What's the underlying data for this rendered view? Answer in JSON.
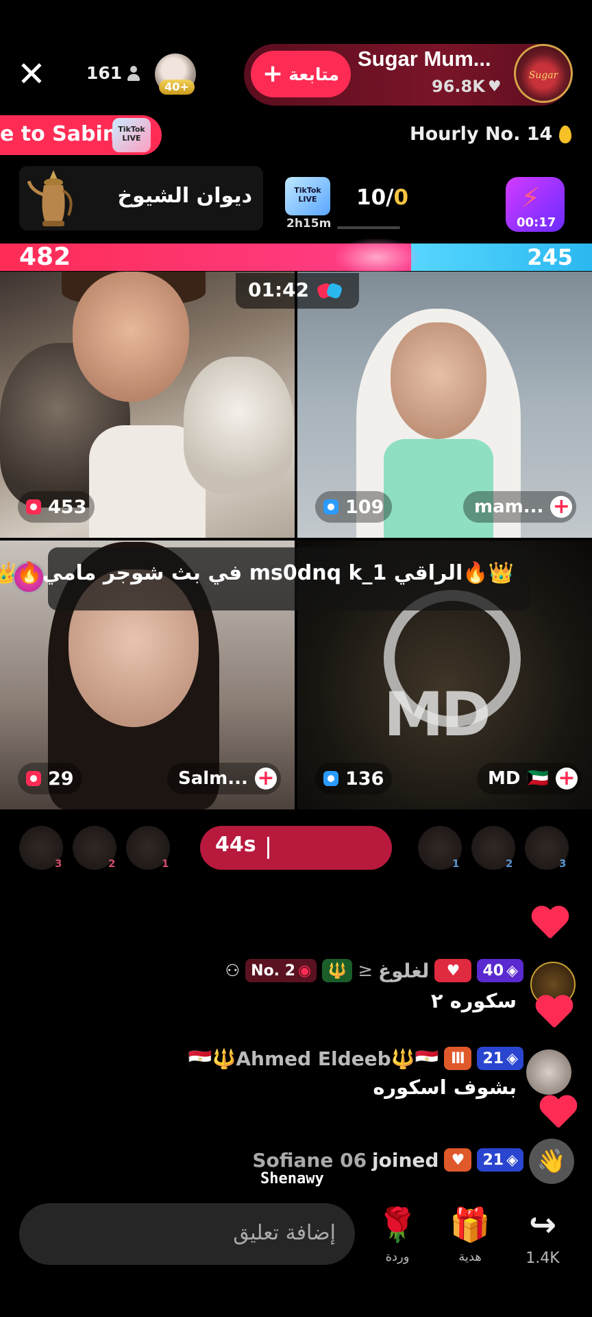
{
  "header": {
    "close_glyph": "✕",
    "viewer_count": "161",
    "top_gifter_badge": "40+",
    "follow_label": "متابعة",
    "follow_plus": "+",
    "host_name": "Sugar Mum...",
    "host_likes": "96.8K",
    "host_avatar_text": "Sugar",
    "heart_glyph": "♥"
  },
  "banners": {
    "sabina_text": "e to Sabina",
    "sabina_icon_text": "TikTok LIVE",
    "hourly_rank": "Hourly No. 14"
  },
  "battle_info": {
    "diwan_name": "ديوان الشيوخ",
    "tiktok_box_text": "TikTok LIVE",
    "tiktok_time": "2h15m",
    "score_prefix": "10/",
    "score_suffix": "0",
    "lightning_time": "00:17",
    "lightning_glyph": "⚡"
  },
  "battle_bar": {
    "left_score": "482",
    "right_score": "245",
    "left_color": "#fe2c55",
    "right_color": "#2bb8f0"
  },
  "grid": {
    "timer": "01:42",
    "tiles": [
      {
        "count": "453",
        "name": ""
      },
      {
        "count": "109",
        "name": "mam..."
      },
      {
        "count": "29",
        "name": "Salm..."
      },
      {
        "count": "136",
        "name": "MD 🇰🇼"
      }
    ],
    "announcement": "👑🔥الراقي ms0dnq k_1 في بث شوجر مامي🔥👑",
    "md_logo": "MD"
  },
  "footer_battle": {
    "countdown": "44s",
    "left_supporter_ranks": [
      "3",
      "2",
      "1"
    ],
    "right_supporter_ranks": [
      "1",
      "2",
      "3"
    ]
  },
  "chat": [
    {
      "user": "لغلوغ",
      "badges": [
        "No. 2",
        "40"
      ],
      "message": "سكوره ٢"
    },
    {
      "user": "🇪🇬🔱Ahmed Eldeeb🔱🇪🇬",
      "badges": [
        "21"
      ],
      "message": "بشوف اسكوره"
    },
    {
      "user": "Sofiane 06",
      "action": "joined",
      "badges": [
        "21"
      ]
    }
  ],
  "watermark": "Shenawy",
  "bottom_bar": {
    "comment_placeholder": "إضافة تعليق",
    "rose_label": "وردة",
    "rose_glyph": "🌹",
    "gift_label": "هدية",
    "gift_glyph": "🎁",
    "share_count": "1.4K",
    "share_glyph": "↪"
  },
  "colors": {
    "accent": "#fe2c55",
    "blue_team": "#2bb8f0",
    "gold": "#f5c542"
  }
}
